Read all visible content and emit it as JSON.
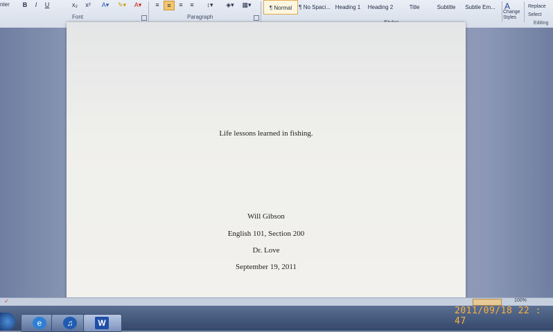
{
  "ribbon": {
    "font_group": "Font",
    "paragraph_group": "Paragraph",
    "styles_group": "Styles",
    "editing_group": "Editing",
    "left_cut": "nter",
    "styles": [
      {
        "label": "¶ Normal"
      },
      {
        "label": "¶ No Spaci..."
      },
      {
        "label": "Heading 1"
      },
      {
        "label": "Heading 2"
      },
      {
        "label": "Title"
      },
      {
        "label": "Subtitle"
      },
      {
        "label": "Subtle Em..."
      }
    ],
    "change_styles": "Change Styles",
    "replace": "Replace",
    "select": "Select"
  },
  "document": {
    "title": "Life lessons learned in fishing.",
    "author": "Will Gibson",
    "course": "English 101, Section 200",
    "instructor": "Dr. Love",
    "date": "September 19, 2011"
  },
  "status": {
    "zoom": "100%"
  },
  "taskbar": {
    "apps": [
      {
        "name": "internet-explorer-icon",
        "glyph": "e"
      },
      {
        "name": "media-player-icon",
        "glyph": "♫"
      },
      {
        "name": "word-icon",
        "glyph": "W"
      }
    ]
  },
  "camera_timestamp": "2011/09/18  22 : 47"
}
